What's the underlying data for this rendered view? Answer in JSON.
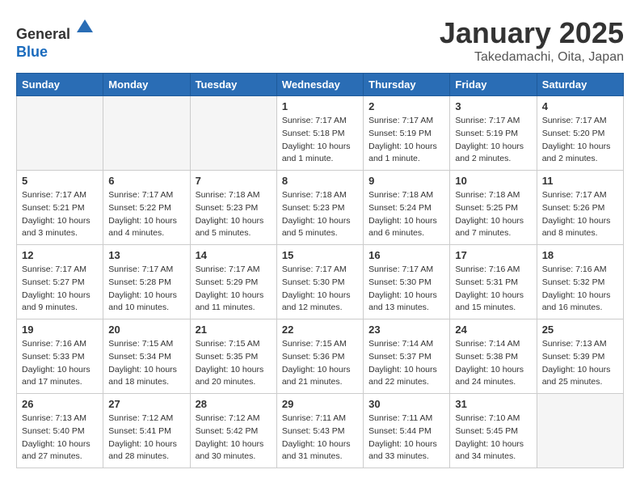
{
  "header": {
    "logo_line1": "General",
    "logo_line2": "Blue",
    "month_title": "January 2025",
    "subtitle": "Takedamachi, Oita, Japan"
  },
  "days_of_week": [
    "Sunday",
    "Monday",
    "Tuesday",
    "Wednesday",
    "Thursday",
    "Friday",
    "Saturday"
  ],
  "weeks": [
    [
      {
        "day": "",
        "info": ""
      },
      {
        "day": "",
        "info": ""
      },
      {
        "day": "",
        "info": ""
      },
      {
        "day": "1",
        "info": "Sunrise: 7:17 AM\nSunset: 5:18 PM\nDaylight: 10 hours\nand 1 minute."
      },
      {
        "day": "2",
        "info": "Sunrise: 7:17 AM\nSunset: 5:19 PM\nDaylight: 10 hours\nand 1 minute."
      },
      {
        "day": "3",
        "info": "Sunrise: 7:17 AM\nSunset: 5:19 PM\nDaylight: 10 hours\nand 2 minutes."
      },
      {
        "day": "4",
        "info": "Sunrise: 7:17 AM\nSunset: 5:20 PM\nDaylight: 10 hours\nand 2 minutes."
      }
    ],
    [
      {
        "day": "5",
        "info": "Sunrise: 7:17 AM\nSunset: 5:21 PM\nDaylight: 10 hours\nand 3 minutes."
      },
      {
        "day": "6",
        "info": "Sunrise: 7:17 AM\nSunset: 5:22 PM\nDaylight: 10 hours\nand 4 minutes."
      },
      {
        "day": "7",
        "info": "Sunrise: 7:18 AM\nSunset: 5:23 PM\nDaylight: 10 hours\nand 5 minutes."
      },
      {
        "day": "8",
        "info": "Sunrise: 7:18 AM\nSunset: 5:23 PM\nDaylight: 10 hours\nand 5 minutes."
      },
      {
        "day": "9",
        "info": "Sunrise: 7:18 AM\nSunset: 5:24 PM\nDaylight: 10 hours\nand 6 minutes."
      },
      {
        "day": "10",
        "info": "Sunrise: 7:18 AM\nSunset: 5:25 PM\nDaylight: 10 hours\nand 7 minutes."
      },
      {
        "day": "11",
        "info": "Sunrise: 7:17 AM\nSunset: 5:26 PM\nDaylight: 10 hours\nand 8 minutes."
      }
    ],
    [
      {
        "day": "12",
        "info": "Sunrise: 7:17 AM\nSunset: 5:27 PM\nDaylight: 10 hours\nand 9 minutes."
      },
      {
        "day": "13",
        "info": "Sunrise: 7:17 AM\nSunset: 5:28 PM\nDaylight: 10 hours\nand 10 minutes."
      },
      {
        "day": "14",
        "info": "Sunrise: 7:17 AM\nSunset: 5:29 PM\nDaylight: 10 hours\nand 11 minutes."
      },
      {
        "day": "15",
        "info": "Sunrise: 7:17 AM\nSunset: 5:30 PM\nDaylight: 10 hours\nand 12 minutes."
      },
      {
        "day": "16",
        "info": "Sunrise: 7:17 AM\nSunset: 5:30 PM\nDaylight: 10 hours\nand 13 minutes."
      },
      {
        "day": "17",
        "info": "Sunrise: 7:16 AM\nSunset: 5:31 PM\nDaylight: 10 hours\nand 15 minutes."
      },
      {
        "day": "18",
        "info": "Sunrise: 7:16 AM\nSunset: 5:32 PM\nDaylight: 10 hours\nand 16 minutes."
      }
    ],
    [
      {
        "day": "19",
        "info": "Sunrise: 7:16 AM\nSunset: 5:33 PM\nDaylight: 10 hours\nand 17 minutes."
      },
      {
        "day": "20",
        "info": "Sunrise: 7:15 AM\nSunset: 5:34 PM\nDaylight: 10 hours\nand 18 minutes."
      },
      {
        "day": "21",
        "info": "Sunrise: 7:15 AM\nSunset: 5:35 PM\nDaylight: 10 hours\nand 20 minutes."
      },
      {
        "day": "22",
        "info": "Sunrise: 7:15 AM\nSunset: 5:36 PM\nDaylight: 10 hours\nand 21 minutes."
      },
      {
        "day": "23",
        "info": "Sunrise: 7:14 AM\nSunset: 5:37 PM\nDaylight: 10 hours\nand 22 minutes."
      },
      {
        "day": "24",
        "info": "Sunrise: 7:14 AM\nSunset: 5:38 PM\nDaylight: 10 hours\nand 24 minutes."
      },
      {
        "day": "25",
        "info": "Sunrise: 7:13 AM\nSunset: 5:39 PM\nDaylight: 10 hours\nand 25 minutes."
      }
    ],
    [
      {
        "day": "26",
        "info": "Sunrise: 7:13 AM\nSunset: 5:40 PM\nDaylight: 10 hours\nand 27 minutes."
      },
      {
        "day": "27",
        "info": "Sunrise: 7:12 AM\nSunset: 5:41 PM\nDaylight: 10 hours\nand 28 minutes."
      },
      {
        "day": "28",
        "info": "Sunrise: 7:12 AM\nSunset: 5:42 PM\nDaylight: 10 hours\nand 30 minutes."
      },
      {
        "day": "29",
        "info": "Sunrise: 7:11 AM\nSunset: 5:43 PM\nDaylight: 10 hours\nand 31 minutes."
      },
      {
        "day": "30",
        "info": "Sunrise: 7:11 AM\nSunset: 5:44 PM\nDaylight: 10 hours\nand 33 minutes."
      },
      {
        "day": "31",
        "info": "Sunrise: 7:10 AM\nSunset: 5:45 PM\nDaylight: 10 hours\nand 34 minutes."
      },
      {
        "day": "",
        "info": ""
      }
    ]
  ]
}
